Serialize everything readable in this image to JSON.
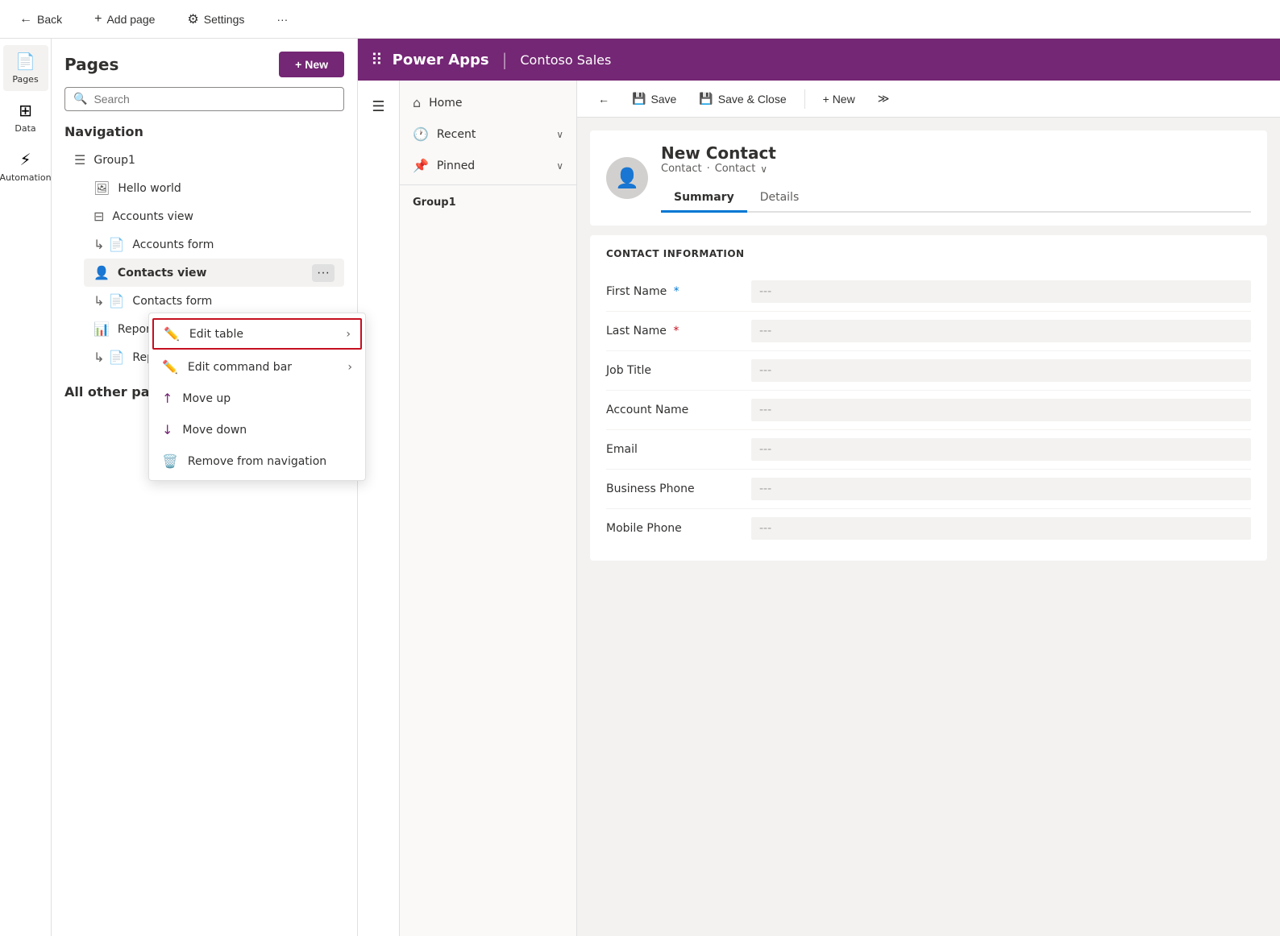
{
  "topbar": {
    "back_label": "Back",
    "add_page_label": "Add page",
    "settings_label": "Settings",
    "more_label": "···"
  },
  "icon_sidebar": {
    "items": [
      {
        "id": "pages",
        "label": "Pages",
        "icon": "📄",
        "active": true
      },
      {
        "id": "data",
        "label": "Data",
        "icon": "⊞",
        "active": false
      },
      {
        "id": "automation",
        "label": "Automation",
        "icon": "⚡",
        "active": false
      }
    ]
  },
  "pages_panel": {
    "title": "Pages",
    "new_button": "+ New",
    "search_placeholder": "Search",
    "navigation_title": "Navigation",
    "nav_items": [
      {
        "id": "group1",
        "label": "Group1",
        "icon": "list",
        "indent": false
      },
      {
        "id": "hello-world",
        "label": "Hello world",
        "icon": "image",
        "indent": true
      },
      {
        "id": "accounts-view",
        "label": "Accounts view",
        "icon": "table",
        "indent": true
      },
      {
        "id": "accounts-form",
        "label": "Accounts form",
        "icon": "form",
        "indent": true
      },
      {
        "id": "contacts-view",
        "label": "Contacts view",
        "icon": "person",
        "indent": true,
        "active": true
      },
      {
        "id": "contacts-form",
        "label": "Contacts form",
        "icon": "form",
        "indent": true
      },
      {
        "id": "reports-view",
        "label": "Reports view",
        "icon": "chart",
        "indent": true
      },
      {
        "id": "reports-form",
        "label": "Reports form",
        "icon": "form",
        "indent": true
      }
    ],
    "all_other_pages_title": "All other pages"
  },
  "context_menu": {
    "items": [
      {
        "id": "edit-table",
        "label": "Edit table",
        "icon": "✏️",
        "has_submenu": true,
        "highlighted": true
      },
      {
        "id": "edit-command-bar",
        "label": "Edit command bar",
        "icon": "✏️",
        "has_submenu": true,
        "highlighted": false
      },
      {
        "id": "move-up",
        "label": "Move up",
        "icon": "↑",
        "has_submenu": false,
        "highlighted": false
      },
      {
        "id": "move-down",
        "label": "Move down",
        "icon": "↓",
        "has_submenu": false,
        "highlighted": false
      },
      {
        "id": "remove-from-nav",
        "label": "Remove from navigation",
        "icon": "🗑️",
        "has_submenu": false,
        "highlighted": false
      }
    ]
  },
  "app": {
    "topbar": {
      "app_name": "Power Apps",
      "divider": "|",
      "subtitle": "Contoso Sales"
    },
    "menu": {
      "items": [
        {
          "id": "home",
          "label": "Home",
          "icon": "⌂",
          "has_chevron": false
        },
        {
          "id": "recent",
          "label": "Recent",
          "icon": "🕐",
          "has_chevron": true
        },
        {
          "id": "pinned",
          "label": "Pinned",
          "icon": "📌",
          "has_chevron": true
        }
      ],
      "group_label": "Group1"
    },
    "toolbar": {
      "back_label": "←",
      "save_label": "Save",
      "save_close_label": "Save & Close",
      "new_label": "+ New",
      "forward_label": "≫"
    },
    "form": {
      "contact_name": "New Contact",
      "contact_sub1": "Contact",
      "contact_sub2": "Contact",
      "tabs": [
        {
          "id": "summary",
          "label": "Summary",
          "active": true
        },
        {
          "id": "details",
          "label": "Details",
          "active": false
        }
      ],
      "section_title": "CONTACT INFORMATION",
      "fields": [
        {
          "id": "first-name",
          "label": "First Name",
          "required_type": "blue",
          "value": "---"
        },
        {
          "id": "last-name",
          "label": "Last Name",
          "required_type": "red",
          "value": "---"
        },
        {
          "id": "job-title",
          "label": "Job Title",
          "required_type": "none",
          "value": "---"
        },
        {
          "id": "account-name",
          "label": "Account Name",
          "required_type": "none",
          "value": "---"
        },
        {
          "id": "email",
          "label": "Email",
          "required_type": "none",
          "value": "---"
        },
        {
          "id": "business-phone",
          "label": "Business Phone",
          "required_type": "none",
          "value": "---"
        },
        {
          "id": "mobile-phone",
          "label": "Mobile Phone",
          "required_type": "none",
          "value": "---"
        }
      ]
    }
  }
}
